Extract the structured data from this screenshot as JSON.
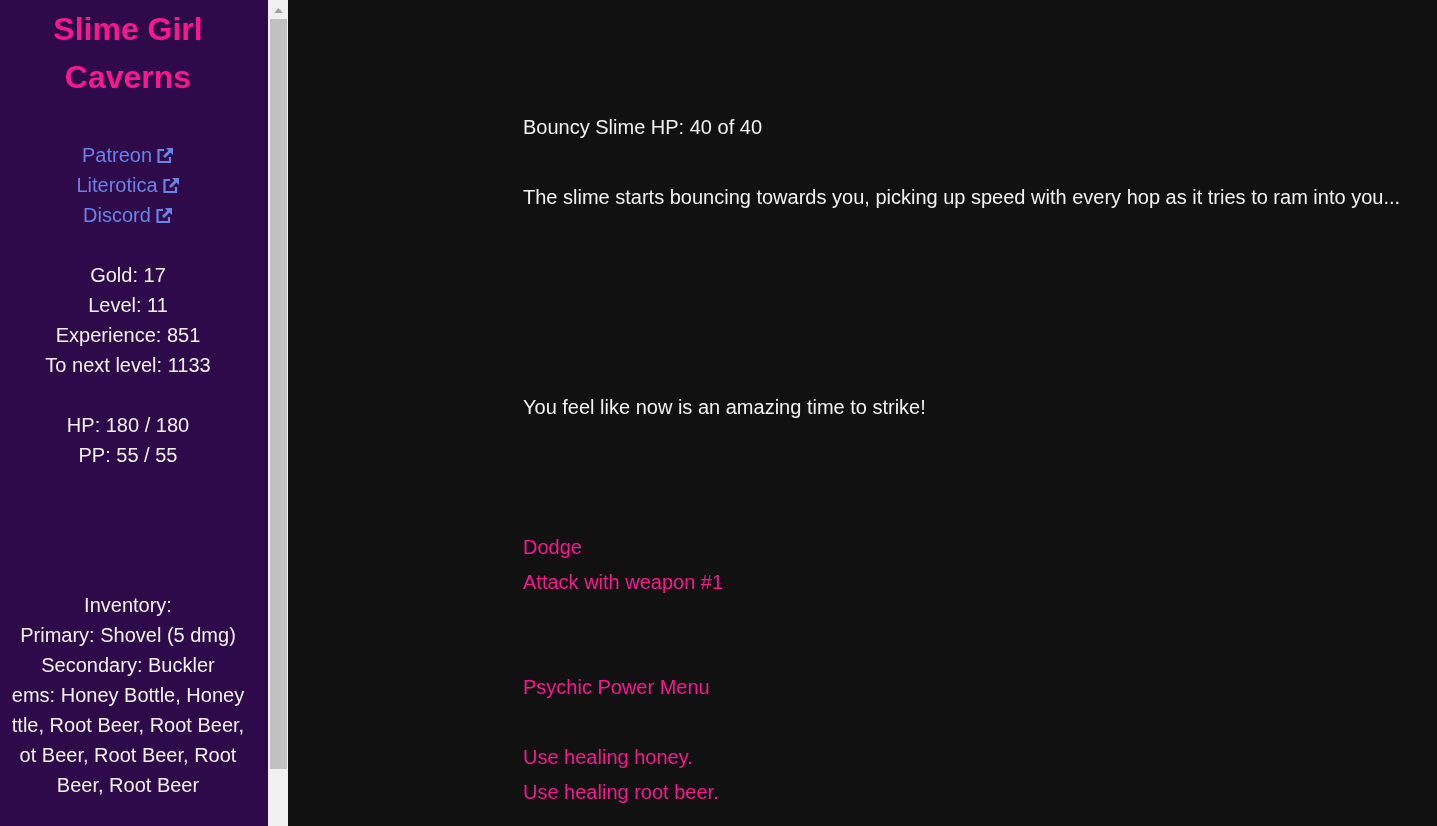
{
  "sidebar": {
    "title": "Slime Girl Caverns",
    "links": [
      {
        "label": "Patreon"
      },
      {
        "label": "Literotica"
      },
      {
        "label": "Discord"
      }
    ],
    "stats": [
      "Gold: 17",
      "Level: 11",
      "Experience: 851",
      "To next level: 1133"
    ],
    "vitals": [
      "HP: 180 / 180",
      "PP: 55 / 55"
    ],
    "inventory": [
      "Inventory:",
      "Primary: Shovel (5 dmg)",
      "Secondary: Buckler",
      "ems: Honey Bottle, Honey",
      "ttle, Root Beer, Root Beer,",
      "ot Beer, Root Beer, Root",
      "Beer, Root Beer"
    ]
  },
  "main": {
    "enemy_status": "Bouncy Slime HP: 40 of 40",
    "narration": "The slime starts bouncing towards you, picking up speed with every hop as it tries to ram into you...",
    "hint": "You feel like now is an amazing time to strike!",
    "action_groups": [
      {
        "options": [
          "Dodge",
          "Attack with weapon #1"
        ]
      },
      {
        "options": [
          "Psychic Power Menu"
        ]
      },
      {
        "options": [
          "Use healing honey.",
          "Use healing root beer."
        ]
      }
    ]
  }
}
